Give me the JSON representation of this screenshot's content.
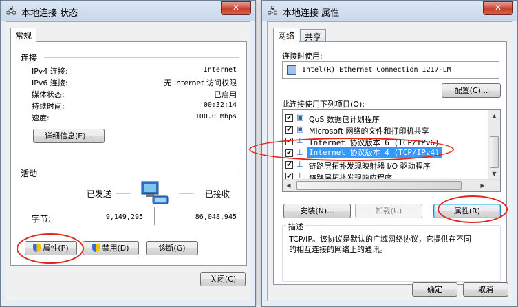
{
  "status_window": {
    "title": "本地连接 状态",
    "close_symbol": "✕",
    "tab_general": "常规",
    "connection_heading": "连接",
    "rows": [
      {
        "label": "IPv4 连接:",
        "value": "Internet"
      },
      {
        "label": "IPv6 连接:",
        "value": "无 Internet 访问权限"
      },
      {
        "label": "媒体状态:",
        "value": "已启用"
      },
      {
        "label": "持续时间:",
        "value": "00:32:14"
      },
      {
        "label": "速度:",
        "value": "100.0 Mbps"
      }
    ],
    "details_button": "详细信息(E)...",
    "activity_heading": "活动",
    "sent_label": "已发送",
    "received_label": "已接收",
    "bytes_label": "字节:",
    "bytes_sent": "9,149,295",
    "bytes_received": "86,048,945",
    "properties_button": "属性(P)",
    "disable_button": "禁用(D)",
    "diagnose_button": "诊断(G)",
    "close_button": "关闭(C)"
  },
  "properties_window": {
    "title": "本地连接 属性",
    "close_symbol": "✕",
    "tab_network": "网络",
    "tab_sharing": "共享",
    "connect_using_label": "连接时使用:",
    "adapter_name": "Intel(R) Ethernet Connection I217-LM",
    "configure_button": "配置(C)...",
    "items_label": "此连接使用下列项目(O):",
    "items": [
      {
        "label": "QoS 数据包计划程序",
        "checked": true,
        "icon": "network-service-icon"
      },
      {
        "label": "Microsoft 网络的文件和打印机共享",
        "checked": true,
        "icon": "network-service-icon"
      },
      {
        "label": "Internet 协议版本 6 (TCP/IPv6)",
        "checked": true,
        "icon": "protocol-icon"
      },
      {
        "label": "Internet 协议版本 4 (TCP/IPv4)",
        "checked": true,
        "icon": "protocol-icon",
        "selected": true
      },
      {
        "label": "链路层拓扑发现映射器 I/O 驱动程序",
        "checked": true,
        "icon": "protocol-icon"
      },
      {
        "label": "链路层拓扑发现响应程序",
        "checked": true,
        "icon": "protocol-icon"
      }
    ],
    "install_button": "安装(N)...",
    "uninstall_button": "卸载(U)",
    "properties_button": "属性(R)",
    "description_heading": "描述",
    "description_text_line1": "TCP/IP。该协议是默认的广域网络协议，它提供在不同",
    "description_text_line2": "的相互连接的网络上的通讯。",
    "ok_button": "确定",
    "cancel_button": "取消"
  },
  "colors": {
    "highlight": "#3399ff",
    "annotation_red": "#e0261c",
    "close_red": "#c7402c"
  },
  "check_mark": "✔"
}
